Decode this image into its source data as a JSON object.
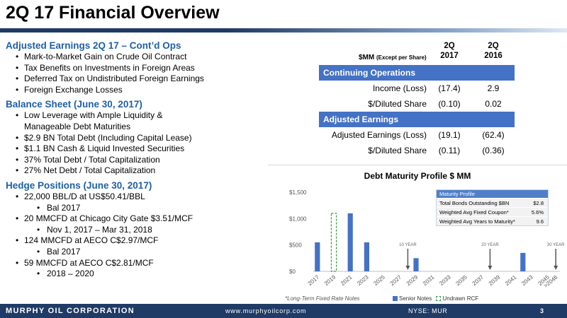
{
  "slide": {
    "title": "2Q 17 Financial Overview",
    "page_number": "3"
  },
  "left": {
    "adjusted_earnings": {
      "heading": "Adjusted Earnings 2Q 17 – Cont’d Ops",
      "bullets": [
        "Mark-to-Market Gain on Crude Oil Contract",
        "Tax Benefits on Investments in Foreign Areas",
        "Deferred Tax on Undistributed Foreign Earnings",
        "Foreign Exchange Losses"
      ]
    },
    "balance_sheet": {
      "heading": "Balance Sheet (June 30, 2017)",
      "bullets": [
        "Low Leverage with Ample Liquidity &",
        "Manageable Debt Maturities",
        "$2.9 BN Total Debt (Including Capital Lease)",
        "$1.1 BN Cash & Liquid Invested Securities",
        "37% Total Debt / Total Capitalization",
        "27% Net Debt / Total Capitalization"
      ]
    },
    "hedge": {
      "heading": "Hedge Positions (June 30, 2017)",
      "items": [
        {
          "text": "22,000 BBL/D at US$50.41/BBL",
          "sub": "Bal 2017"
        },
        {
          "text": "20 MMCFD at Chicago City Gate $3.51/MCF",
          "sub": "Nov 1, 2017 – Mar 31, 2018"
        },
        {
          "text": "124 MMCFD at AECO C$2.97/MCF",
          "sub": "Bal 2017"
        },
        {
          "text": "59 MMCFD at AECO C$2.81/MCF",
          "sub": "2018 – 2020"
        }
      ]
    }
  },
  "financials": {
    "header_label": "$MM",
    "header_sub": "(Except per Share)",
    "col1": [
      "2Q",
      "2017"
    ],
    "col2": [
      "2Q",
      "2016"
    ],
    "continuing_ops_label": "Continuing Operations",
    "adjusted_label": "Adjusted Earnings",
    "rows": {
      "income": {
        "label": "Income (Loss)",
        "v2017": "(17.4)",
        "v2016": "2.9"
      },
      "diluted1": {
        "label": "$/Diluted Share",
        "v2017": "(0.10)",
        "v2016": "0.02"
      },
      "adj": {
        "label": "Adjusted Earnings (Loss)",
        "v2017": "(19.1)",
        "v2016": "(62.4)"
      },
      "diluted2": {
        "label": "$/Diluted Share",
        "v2017": "(0.11)",
        "v2016": "(0.36)"
      }
    }
  },
  "maturity_profile": {
    "header": "Maturity Profile",
    "rows": [
      {
        "label": "Total Bonds Outstanding $BN",
        "value": "$2.8"
      },
      {
        "label": "Weighted Avg Fixed Coupon*",
        "value": "5.6%"
      },
      {
        "label": "Weighted Avg Years to Maturity*",
        "value": "9.6"
      }
    ]
  },
  "chart_note": "*Long-Term Fixed Rate Notes",
  "chart_data": {
    "type": "bar",
    "title": "Debt Maturity Profile $ MM",
    "categories": [
      "2017",
      "2018",
      "2019",
      "2020",
      "2021",
      "2022",
      "2023",
      "2024",
      "2025",
      "2026",
      "2027",
      "2028",
      "2029",
      "2030",
      "2031",
      "2032",
      "2033",
      "2034",
      "2035",
      "2036",
      "2037",
      "2038",
      "2039",
      "2040",
      "2041",
      "2042",
      "2043",
      "2044",
      "2045",
      ">2046"
    ],
    "tick_labels": [
      "2017",
      "2019",
      "2021",
      "2023",
      "2025",
      "2027",
      "2029",
      "2031",
      "2033",
      "2035",
      "2037",
      "2039",
      "2041",
      "2043",
      "2045",
      ">2046"
    ],
    "tick_indices": [
      0,
      2,
      4,
      6,
      8,
      10,
      12,
      14,
      16,
      18,
      20,
      22,
      24,
      26,
      28,
      29
    ],
    "series": [
      {
        "name": "Senior Notes",
        "color": "#4472c4",
        "values": [
          550,
          0,
          0,
          0,
          1100,
          0,
          550,
          0,
          0,
          0,
          0,
          0,
          250,
          0,
          0,
          0,
          0,
          0,
          0,
          0,
          0,
          0,
          0,
          0,
          0,
          350,
          0,
          0,
          0,
          0
        ]
      },
      {
        "name": "Undrawn RCF",
        "color": "#2e9e3e",
        "values": [
          0,
          0,
          1100,
          0,
          0,
          0,
          0,
          0,
          0,
          0,
          0,
          0,
          0,
          0,
          0,
          0,
          0,
          0,
          0,
          0,
          0,
          0,
          0,
          0,
          0,
          0,
          0,
          0,
          0,
          0
        ]
      }
    ],
    "ylim": [
      0,
      1500
    ],
    "yticks": [
      0,
      500,
      1000,
      1500
    ],
    "ytick_labels": [
      "$0",
      "$500",
      "$1,000",
      "$1,500"
    ],
    "grid": false,
    "annotations": [
      {
        "text": "10 YEAR",
        "at": 11
      },
      {
        "text": "20 YEAR",
        "at": 21
      },
      {
        "text": "30 YEAR",
        "at": 29
      }
    ]
  },
  "footer": {
    "company": "MURPHY OIL CORPORATION",
    "website": "www.murphyoilcorp.com",
    "ticker": "NYSE: MUR"
  }
}
